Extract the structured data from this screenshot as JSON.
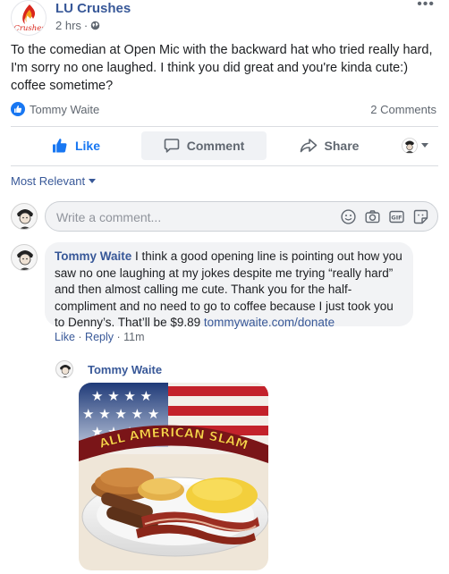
{
  "post": {
    "page_name": "LU Crushes",
    "time": "2 hrs",
    "separator": "·",
    "avatar_text": "Crushes",
    "more": "•••",
    "text": "To the comedian at Open Mic with the backward hat who tried really hard, I'm sorry no one laughed. I think you did great and you're kinda cute:) coffee sometime?",
    "reactor": "Tommy Waite",
    "comments_count": "2 Comments"
  },
  "actions": {
    "like": "Like",
    "comment": "Comment",
    "share": "Share"
  },
  "sort_label": "Most Relevant",
  "composer": {
    "placeholder": "Write a comment..."
  },
  "comment": {
    "author": "Tommy Waite",
    "text": " I think a good opening line is pointing out how you saw no one laughing at my jokes despite me trying “really hard” and then almost calling me cute. Thank you for the half-compliment and no need to go to coffee because I just took you to Denny’s. That’ll be $9.89 ",
    "link": "tommywaite.com/donate",
    "like": "Like",
    "dot": " · ",
    "reply": "Reply",
    "dot2": " · ",
    "time": "11m"
  },
  "reply": {
    "author": "Tommy Waite",
    "image_text": "ALL AMERICAN SLAM"
  },
  "colors": {
    "brand_blue": "#1877f2",
    "link_blue": "#385898",
    "meta_gray": "#606770",
    "bubble_bg": "#f2f3f5",
    "logo_red": "#d9261c"
  }
}
